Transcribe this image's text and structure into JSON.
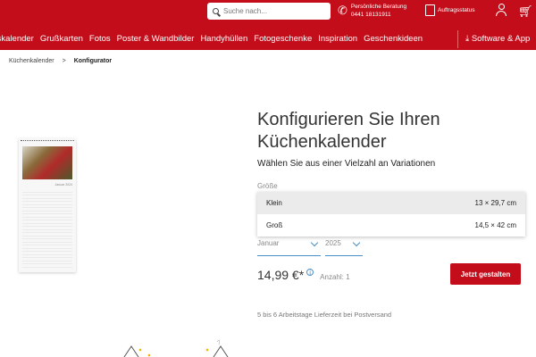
{
  "header": {
    "search_placeholder": "Suche nach...",
    "contact_title": "Persönliche Beratung",
    "contact_phone": "0441 18131911",
    "order_status": "Auftragsstatus",
    "nav": [
      "tskalender",
      "Grußkarten",
      "Fotos",
      "Poster & Wandbilder",
      "Handyhüllen",
      "Fotogeschenke",
      "Inspiration",
      "Geschenkideen"
    ],
    "software": "Software & App"
  },
  "breadcrumb": {
    "items": [
      "Küchenkalender",
      "Konfigurator"
    ],
    "separator": ">"
  },
  "product": {
    "preview_month": "Januar 2024",
    "title": "Konfigurieren Sie Ihren Küchenkalender",
    "subtitle": "Wählen Sie aus einer Vielzahl an Variationen",
    "size_label": "Größe",
    "sizes": [
      {
        "name": "Klein",
        "dims": "13 × 29,7 cm",
        "selected": true
      },
      {
        "name": "Groß",
        "dims": "14,5 × 42 cm",
        "selected": false
      }
    ],
    "month": "Januar",
    "year": "2025",
    "price": "14,99 €*",
    "info_icon": "ⓘ",
    "quantity": "Anzahl: 1",
    "cta": "Jetzt gestalten",
    "delivery": "5 bis 6 Arbeitstage Lieferzeit bei Postversand"
  },
  "colors": {
    "brand": "#c30d1a",
    "accent": "#4a90c8"
  }
}
